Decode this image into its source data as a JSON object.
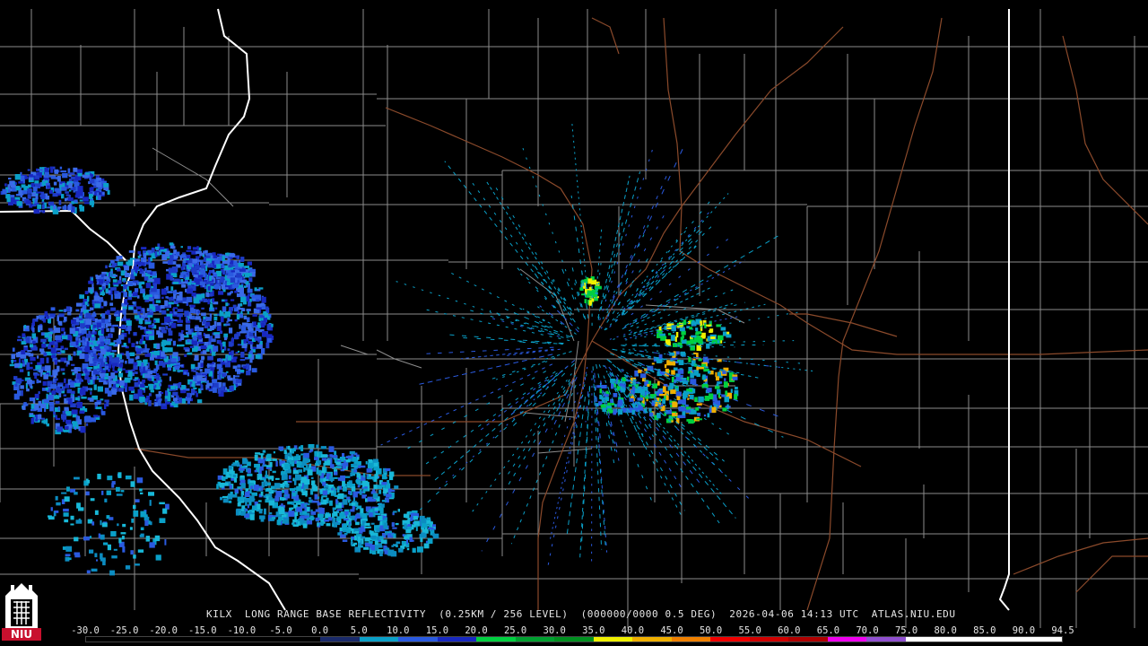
{
  "radar": {
    "site": "KILX",
    "product": "LONG RANGE BASE REFLECTIVITY",
    "resolution": "(0.25KM / 256 LEVEL)",
    "volume": "(000000/0000 0.5 DEG)",
    "timestamp": "2026-04-06 14:13 UTC",
    "source": "ATLAS.NIU.EDU"
  },
  "scale": {
    "labels": [
      "-30.0",
      "-25.0",
      "-20.0",
      "-15.0",
      "-10.0",
      "-5.0",
      "0.0",
      "5.0",
      "10.0",
      "15.0",
      "20.0",
      "25.0",
      "30.0",
      "35.0",
      "40.0",
      "45.0",
      "50.0",
      "55.0",
      "60.0",
      "65.0",
      "70.0",
      "75.0",
      "80.0",
      "85.0",
      "90.0",
      "94.5"
    ],
    "colors": [
      "#000000",
      "#000000",
      "#000000",
      "#000000",
      "#000000",
      "#000000",
      "#1a2a6a",
      "#0aa0c8",
      "#2a5ae0",
      "#1828c0",
      "#00d040",
      "#00a030",
      "#009020",
      "#f0f000",
      "#f0b000",
      "#f08000",
      "#f00000",
      "#d00000",
      "#b00000",
      "#f000f0",
      "#9050d0",
      "#ffffff",
      "#ffffff",
      "#ffffff",
      "#ffffff"
    ]
  },
  "logo": {
    "text": "NIU",
    "color": "#c8102e"
  },
  "map_colors": {
    "county": "#9a9a9a",
    "state": "#ffffff",
    "road": "#a0522d"
  }
}
